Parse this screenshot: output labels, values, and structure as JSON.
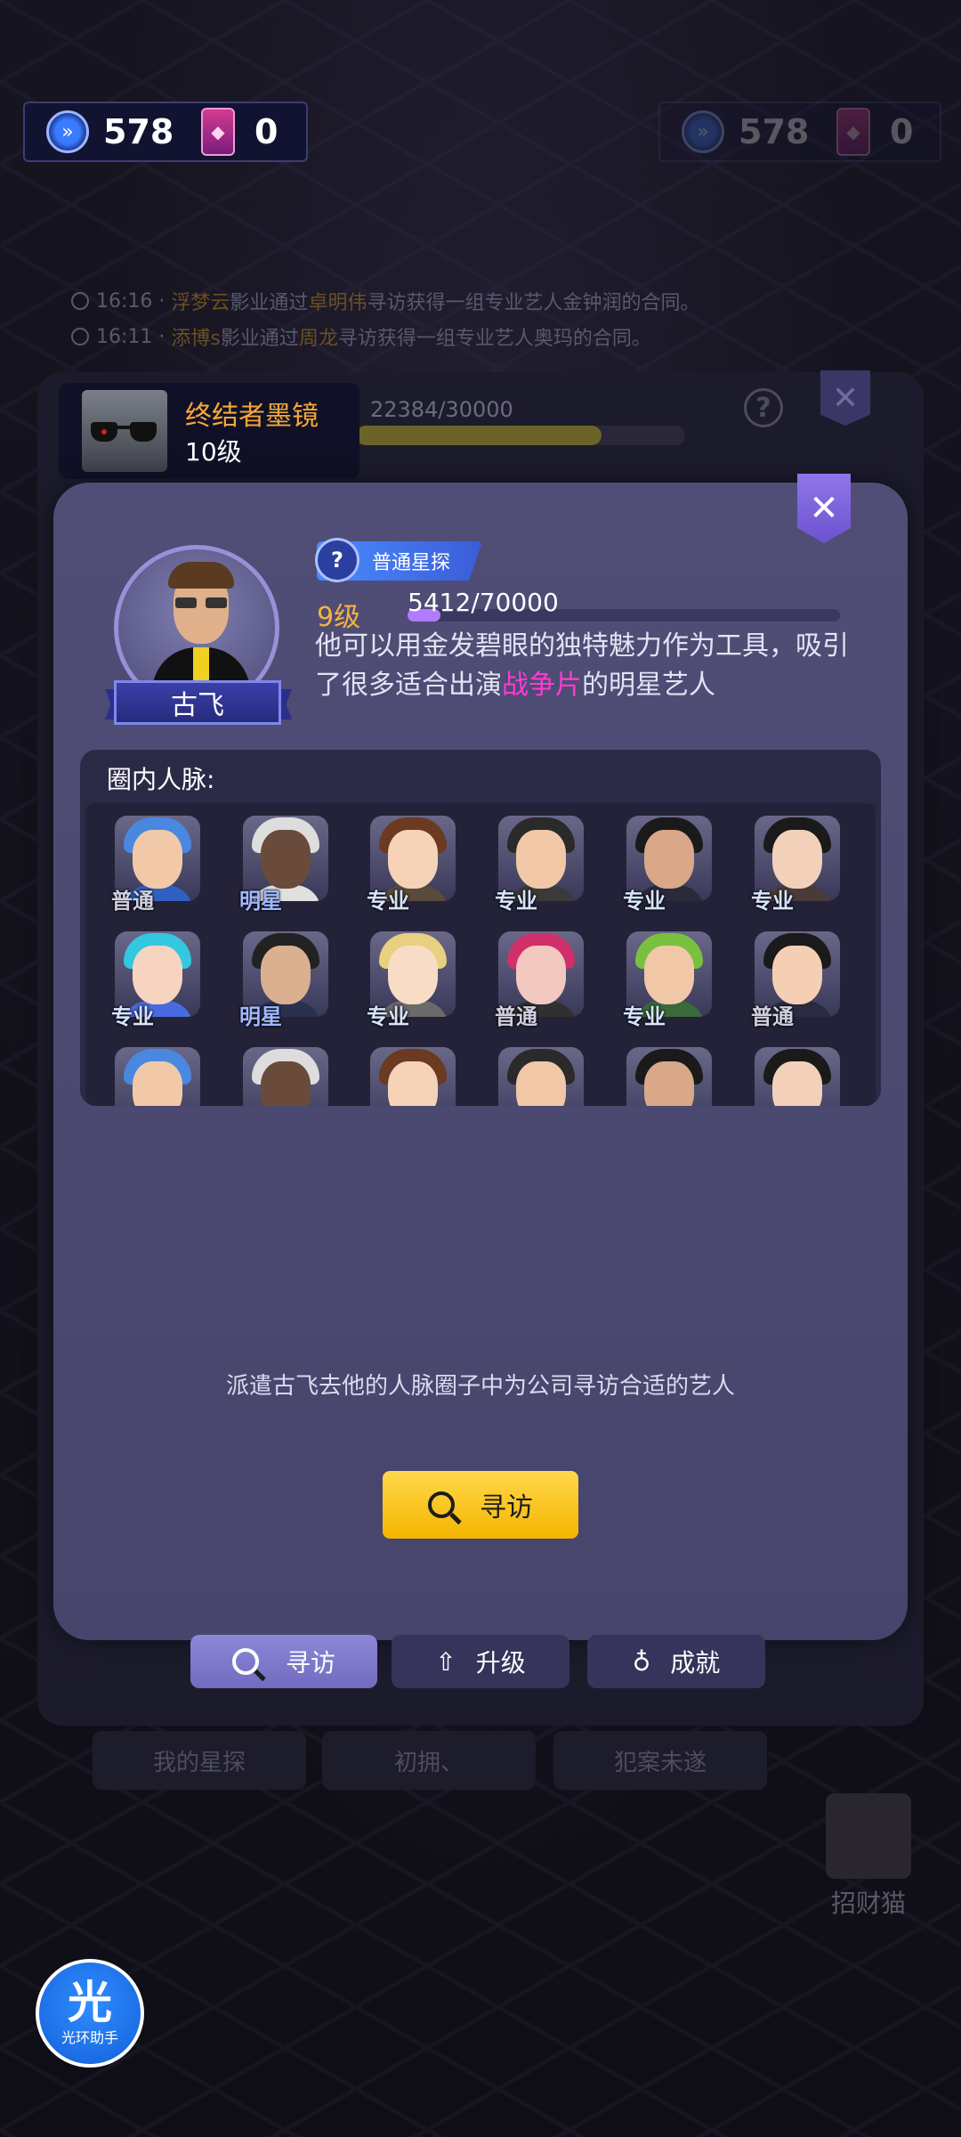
{
  "resources_left": {
    "timer_value": "578",
    "card_value": "0"
  },
  "resources_right": {
    "timer_value": "578",
    "card_value": "0"
  },
  "news": [
    {
      "time": "16:16",
      "sep": "·",
      "studio": "浮梦云",
      "t1": "影业通过",
      "scout": "卓明伟",
      "t2": "寻访获得一组专业艺人金钟润的合同。"
    },
    {
      "time": "16:11",
      "sep": "·",
      "studio": "添博s",
      "t1": "影业通过",
      "scout": "周龙",
      "t2": "寻访获得一组专业艺人奥玛的合同。"
    }
  ],
  "back_panel": {
    "progress_text": "22384/30000",
    "progress_fraction": 0.746
  },
  "item_badge": {
    "name": "终结者墨镜",
    "level": "10级"
  },
  "scout": {
    "name": "古飞",
    "type_label": "普通星探",
    "level": "9级",
    "xp_text": "5412/70000",
    "xp_fraction": 0.077,
    "desc_part1": "他可以用金发碧眼的独特魅力作为工具，吸引了很多适合出演",
    "desc_highlight": "战争片",
    "desc_part2": "的明星艺人"
  },
  "connections": {
    "title": "圈内人脉:",
    "tiers_row1": [
      "普通",
      "明星",
      "专业",
      "专业",
      "专业",
      "专业"
    ],
    "tiers_row2": [
      "专业",
      "明星",
      "专业",
      "普通",
      "专业",
      "普通"
    ]
  },
  "hint": "派遣古飞去他的人脉圈子中为公司寻访合适的艺人",
  "search_button": "寻访",
  "tabs": [
    {
      "label": "寻访",
      "icon": "search-icon"
    },
    {
      "label": "升级",
      "icon": "upgrade-arrow-icon"
    },
    {
      "label": "成就",
      "icon": "medal-icon"
    }
  ],
  "dim_tabs": [
    "我的星探",
    "初拥、",
    "犯案未遂"
  ],
  "cat": "招财猫",
  "helper": {
    "big": "光",
    "small": "光环助手"
  },
  "colors": {
    "accent_yellow": "#f5b400",
    "modal_bg": "#4c4a71",
    "highlight_pink": "#ff3bd0",
    "level_orange": "#f7b23f"
  }
}
